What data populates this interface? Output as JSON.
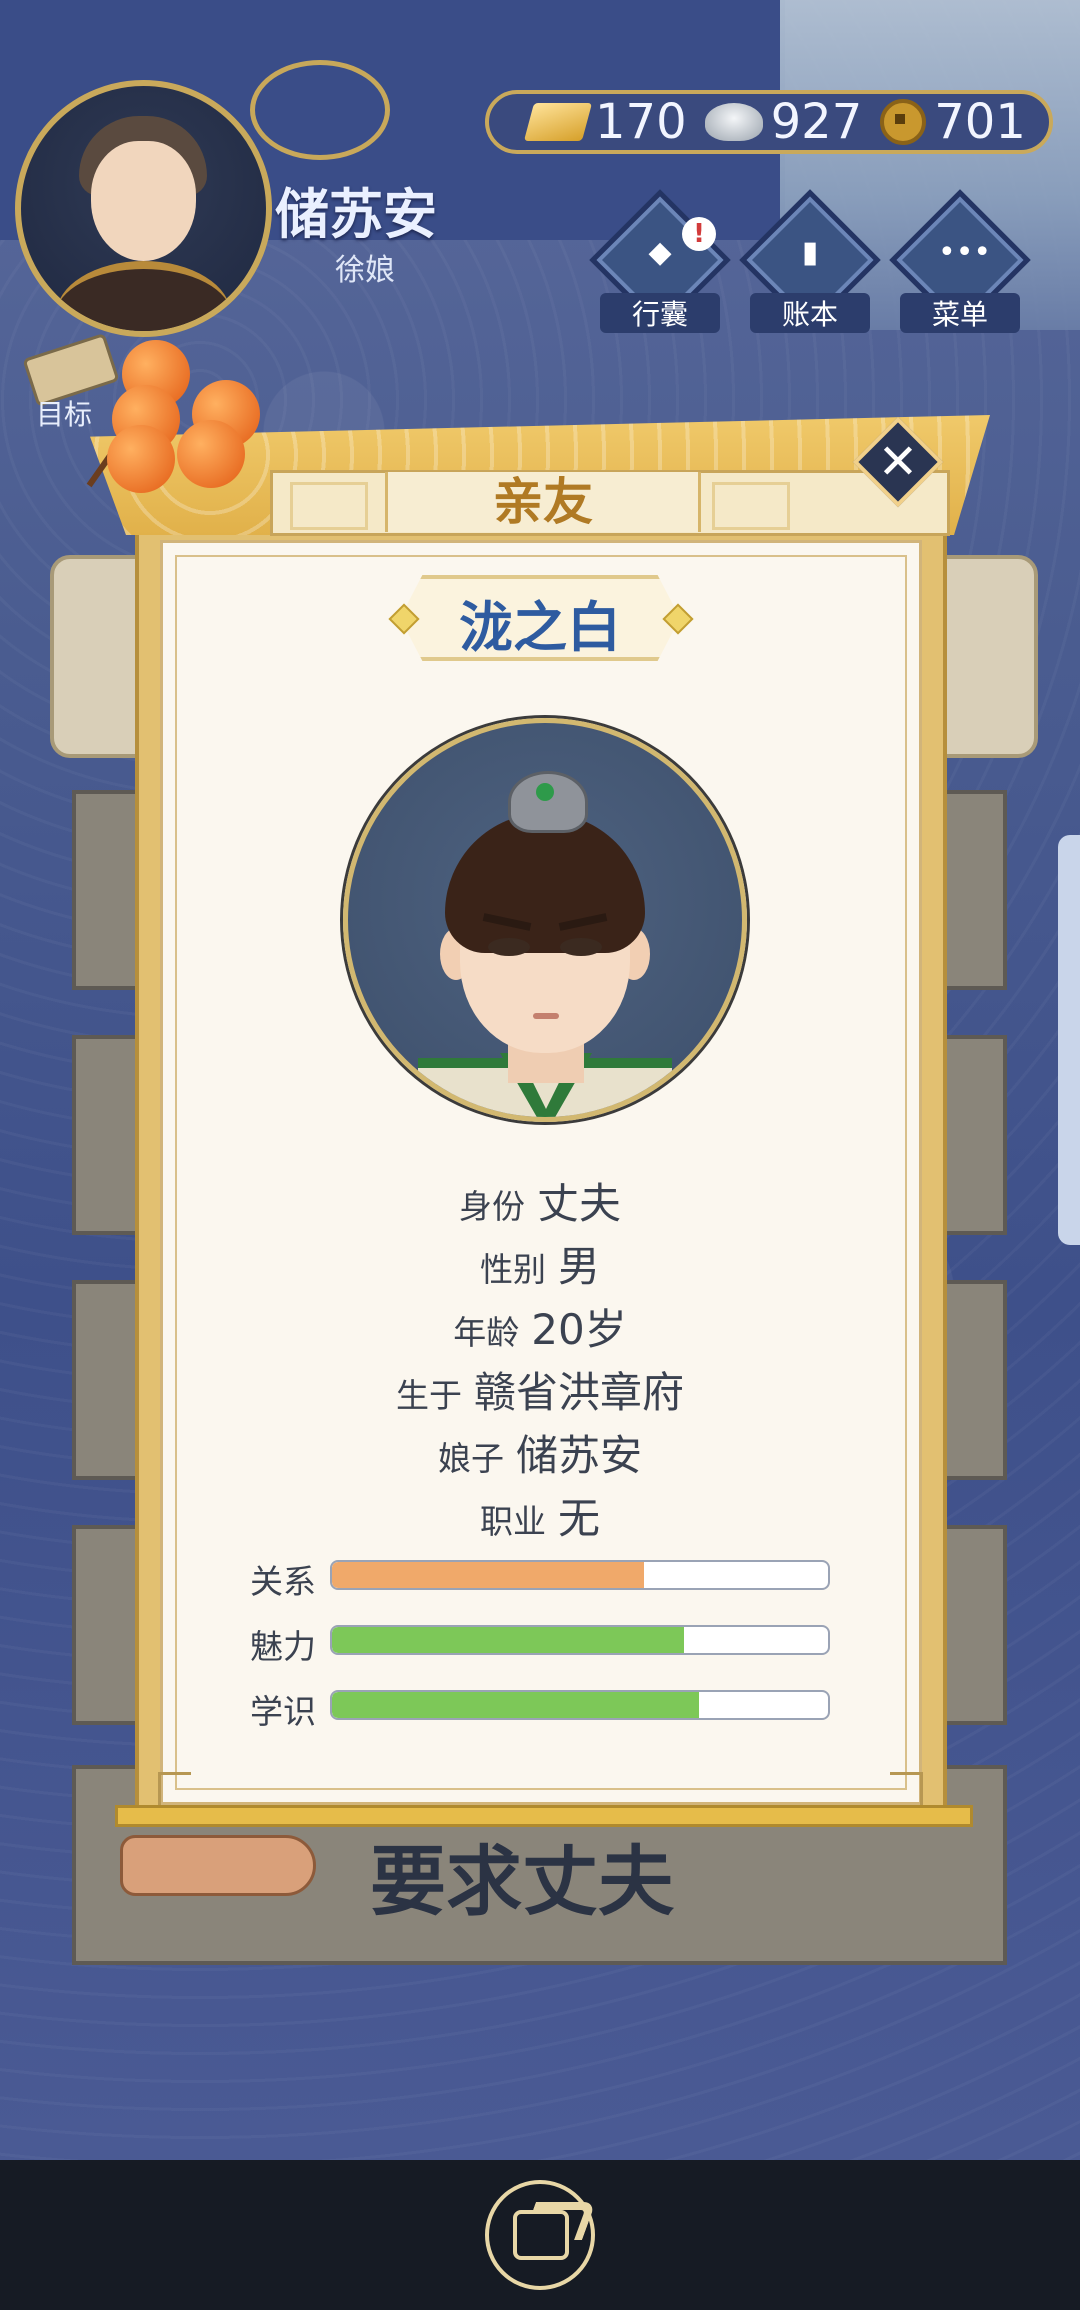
{
  "player": {
    "name": "储苏安",
    "subtitle": "徐娘"
  },
  "currency": {
    "gold": "170",
    "silver": "927",
    "coins": "701"
  },
  "top_buttons": [
    {
      "label": "行囊",
      "icon": "bag-icon",
      "alert": "!"
    },
    {
      "label": "账本",
      "icon": "ledger-icon"
    },
    {
      "label": "菜单",
      "icon": "menu-dots-icon"
    }
  ],
  "goal_label": "目标",
  "modal": {
    "title": "亲友",
    "person_name": "泷之白",
    "info": [
      {
        "label": "身份",
        "value": "丈夫"
      },
      {
        "label": "性别",
        "value": "男"
      },
      {
        "label": "年龄",
        "value": "20岁"
      },
      {
        "label": "生于",
        "value": "赣省洪章府"
      },
      {
        "label": "娘子",
        "value": "储苏安"
      },
      {
        "label": "职业",
        "value": "无"
      }
    ],
    "stats": [
      {
        "label": "关系",
        "value": 0.63,
        "color": "#f0a96a"
      },
      {
        "label": "魅力",
        "value": 0.71,
        "color": "#7dc858"
      },
      {
        "label": "学识",
        "value": 0.74,
        "color": "#7dc858"
      }
    ],
    "close_symbol": "✕"
  },
  "request_button": "要求丈夫",
  "colors": {
    "accent_gold": "#e2c071",
    "name_blue": "#2e5ba0",
    "background": "#3d4f86"
  }
}
